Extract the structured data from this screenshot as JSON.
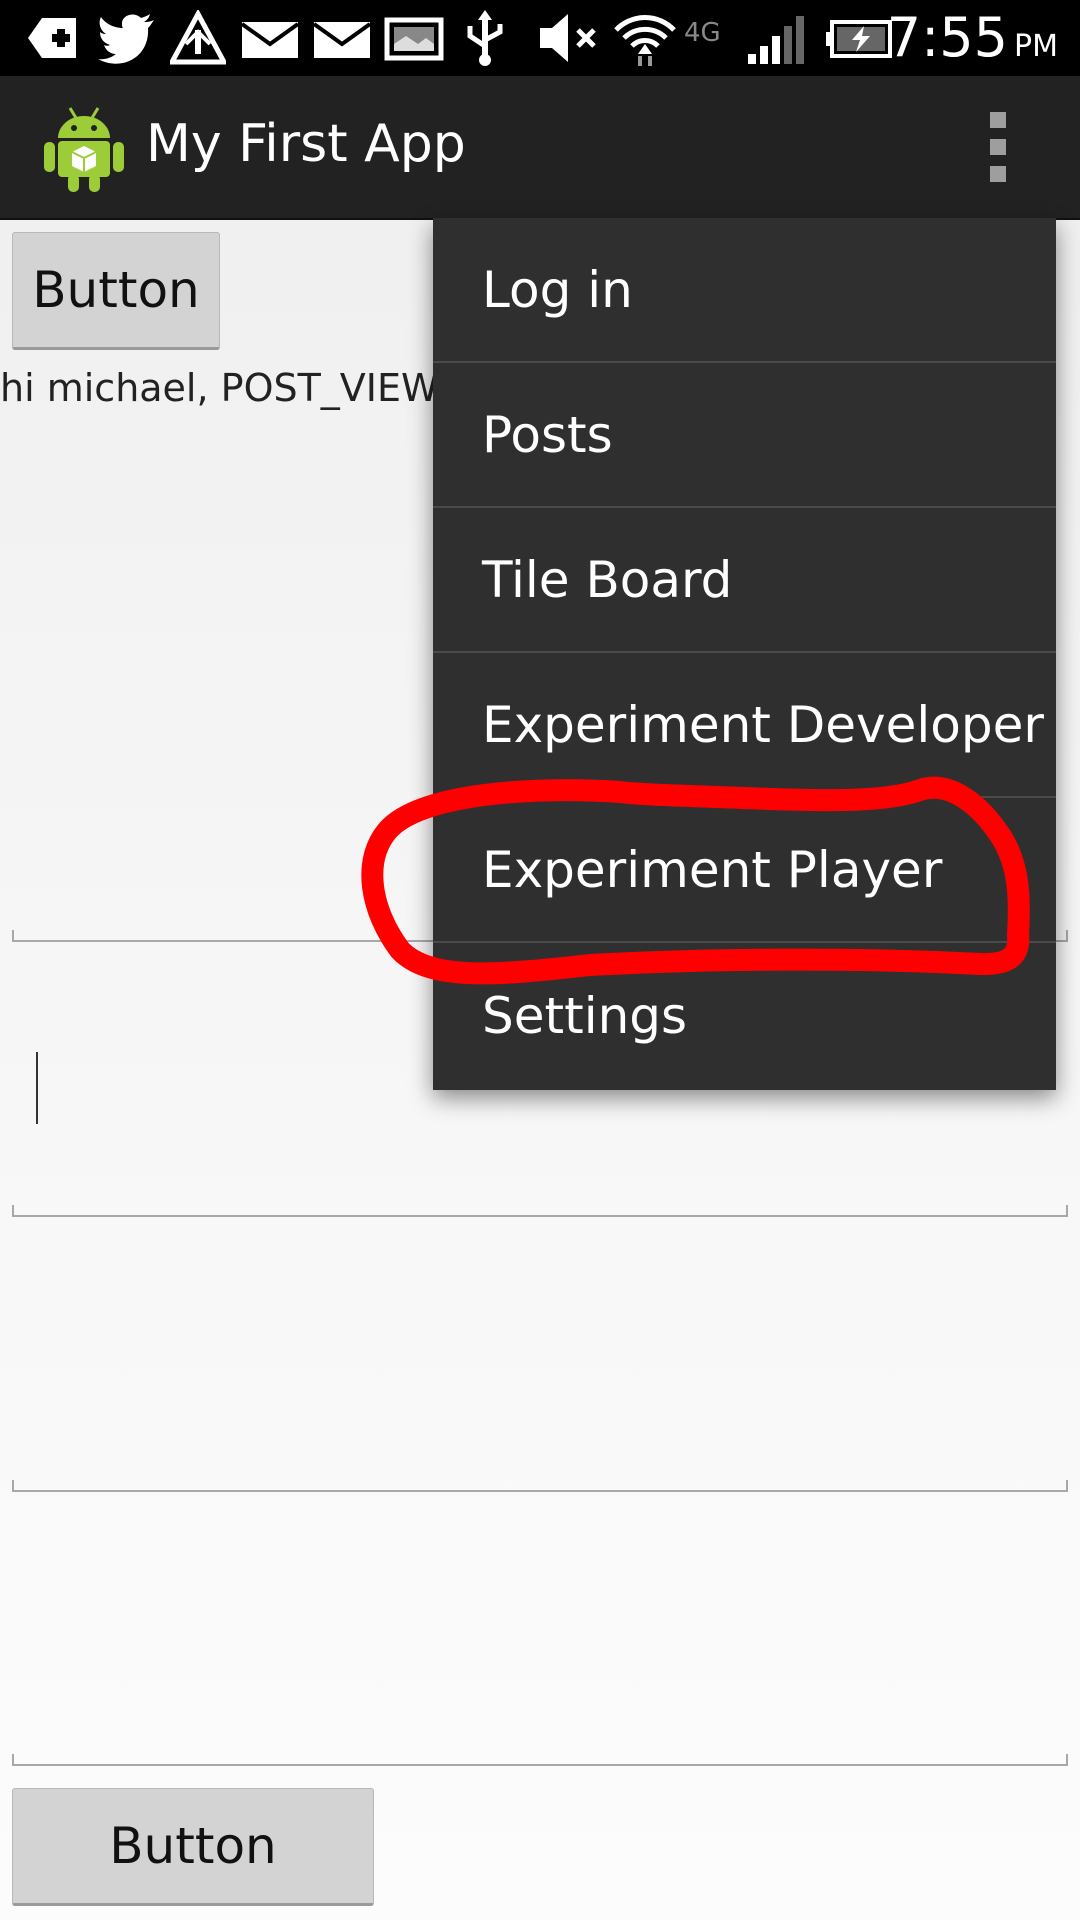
{
  "status_bar": {
    "time": "7:55",
    "ampm": "PM",
    "network": "4G",
    "icons": [
      "add-box-icon",
      "twitter-icon",
      "warning-icon",
      "mail-icon",
      "mail-icon",
      "image-icon",
      "usb-icon",
      "mute-icon",
      "wifi-icon",
      "network-4g-icon",
      "signal-icon",
      "battery-charging-icon"
    ]
  },
  "action_bar": {
    "title": "My First App",
    "app_icon": "android-icon",
    "overflow_icon": "overflow-menu-icon"
  },
  "content": {
    "top_button_label": "Button",
    "greeting_text": "hi michael, POST_VIEW",
    "bottom_button_label": "Button"
  },
  "menu": {
    "items": [
      {
        "label": "Log in"
      },
      {
        "label": "Posts"
      },
      {
        "label": "Tile Board"
      },
      {
        "label": "Experiment Developer"
      },
      {
        "label": "Experiment Player"
      },
      {
        "label": "Settings"
      }
    ]
  },
  "annotation": {
    "color": "#ff0000",
    "highlighted_item": "Experiment Player"
  },
  "colors": {
    "status_bar_bg": "#000000",
    "action_bar_bg": "#222222",
    "menu_bg": "#2f2f2f",
    "button_bg": "#d3d3d3"
  }
}
